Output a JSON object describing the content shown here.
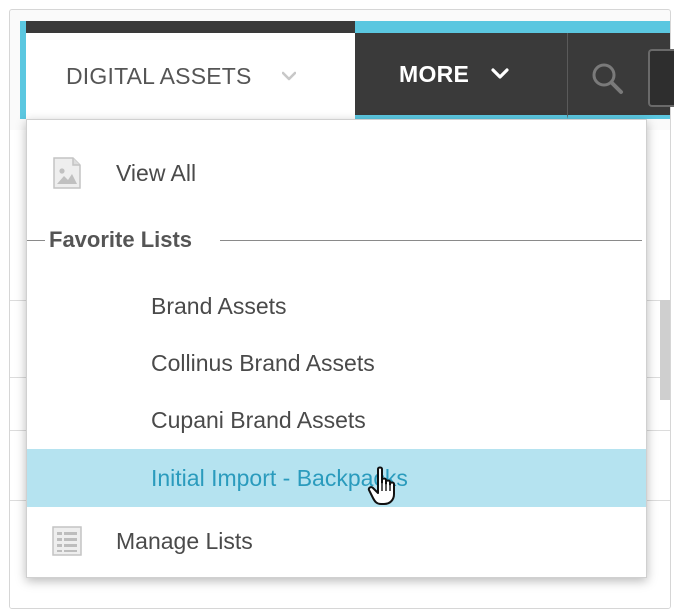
{
  "nav": {
    "digital_assets_label": "DIGITAL ASSETS",
    "more_label": "MORE"
  },
  "menu": {
    "view_all_label": "View All",
    "favorites_header": "Favorite Lists",
    "favorites": [
      {
        "label": "Brand Assets"
      },
      {
        "label": "Collinus Brand Assets"
      },
      {
        "label": "Cupani Brand Assets"
      },
      {
        "label": "Initial Import - Backpacks",
        "highlighted": true
      }
    ],
    "manage_lists_label": "Manage Lists"
  },
  "icons": {
    "view_all": "image-icon",
    "manage_lists": "list-icon",
    "search": "search-icon",
    "cursor": "hand-pointer-icon"
  },
  "colors": {
    "accent": "#5bc7e0",
    "nav_dark": "#3a3a3a",
    "highlight_bg": "#b5e3f0",
    "highlight_text": "#2a9bbd"
  }
}
